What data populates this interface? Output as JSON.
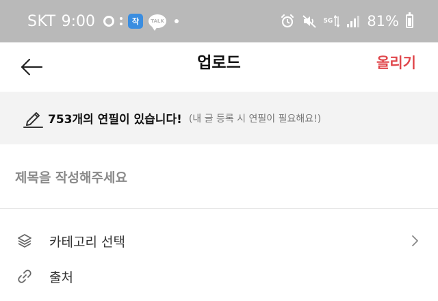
{
  "status_bar": {
    "carrier": "SKT",
    "time": "9:00",
    "blue_app_glyph": "작",
    "talk_badge": "TALK",
    "network": "5G",
    "battery_percent": "81%"
  },
  "header": {
    "title": "업로드",
    "upload_label": "올리기",
    "upload_color": "#e0474c"
  },
  "notice": {
    "icon": "pencil-icon",
    "main_text": "753개의 연필이 있습니다!",
    "sub_text": "(내 글 등록 시 연필이 필요해요!)"
  },
  "title_field": {
    "placeholder": "제목을 작성해주세요",
    "value": ""
  },
  "options": [
    {
      "icon": "layers-icon",
      "label": "카테고리 선택",
      "has_chevron": true
    },
    {
      "icon": "link-icon",
      "label": "출처",
      "has_chevron": false
    }
  ]
}
